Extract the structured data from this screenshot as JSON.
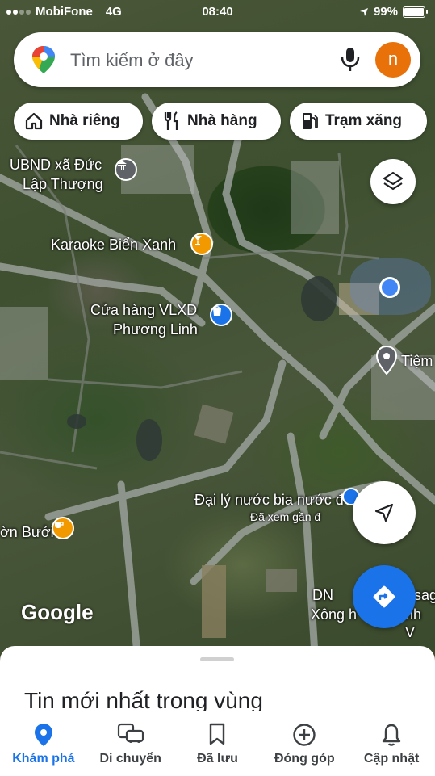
{
  "status_bar": {
    "carrier": "MobiFone",
    "network": "4G",
    "time": "08:40",
    "battery": "99%",
    "battery_level": 0.99
  },
  "search": {
    "placeholder": "Tìm kiếm ở đây",
    "avatar_letter": "n"
  },
  "chips": [
    {
      "label": "Nhà riêng",
      "icon": "home-icon"
    },
    {
      "label": "Nhà hàng",
      "icon": "restaurant-icon"
    },
    {
      "label": "Trạm xăng",
      "icon": "gas-station-icon"
    }
  ],
  "map": {
    "labels": [
      {
        "text": "UBND xã Đức"
      },
      {
        "text": "Lập Thượng"
      },
      {
        "text": "Karaoke Biển Xanh"
      },
      {
        "text": "Cửa hàng VLXD"
      },
      {
        "text": "Phương Linh"
      },
      {
        "text": "Tiệm"
      },
      {
        "text": "Đại lý nước bia nước đ"
      },
      {
        "text": "Đã xem gần đ"
      },
      {
        "text": "ờn Bưởi"
      },
      {
        "text": "DN"
      },
      {
        "text": "sag"
      },
      {
        "text": "Xông h"
      },
      {
        "text": "nh V"
      }
    ],
    "logo": "Google"
  },
  "sheet": {
    "title": "Tin mới nhất trong vùng"
  },
  "nav": [
    {
      "label": "Khám phá",
      "icon": "explore-pin-icon",
      "active": true
    },
    {
      "label": "Di chuyển",
      "icon": "commute-icon",
      "active": false
    },
    {
      "label": "Đã lưu",
      "icon": "bookmark-icon",
      "active": false
    },
    {
      "label": "Đóng góp",
      "icon": "add-circle-icon",
      "active": false
    },
    {
      "label": "Cập nhật",
      "icon": "bell-icon",
      "active": false
    }
  ],
  "colors": {
    "accent": "#1a73e8",
    "avatar": "#e8710a",
    "poi_orange": "#f29900",
    "poi_blue": "#1a73e8",
    "poi_gray": "#5f6368"
  }
}
